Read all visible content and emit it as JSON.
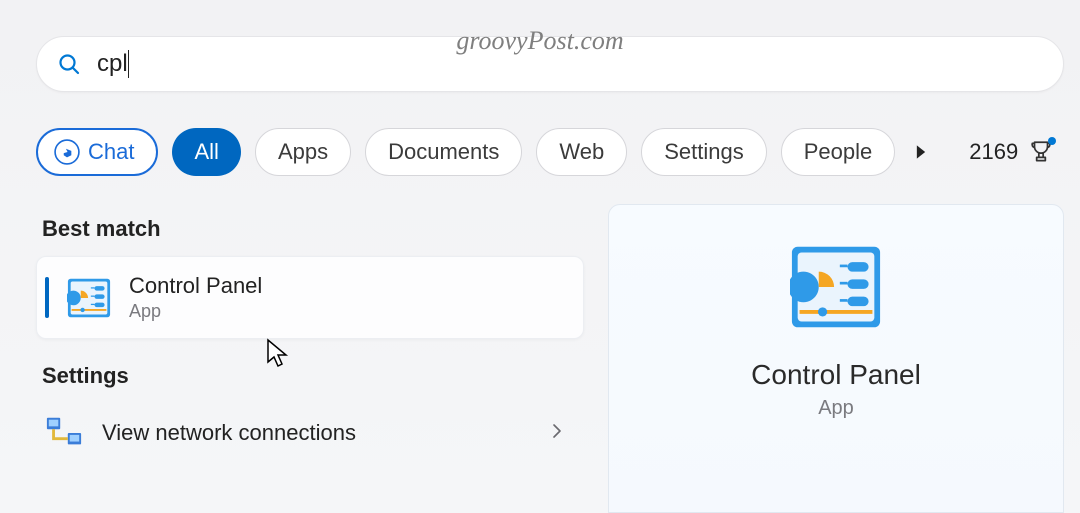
{
  "watermark": "groovyPost.com",
  "search": {
    "value": "cpl"
  },
  "filters": {
    "chat": "Chat",
    "all": "All",
    "items": [
      "Apps",
      "Documents",
      "Web",
      "Settings",
      "People"
    ]
  },
  "points": {
    "value": "2169"
  },
  "sections": {
    "best_match": "Best match",
    "settings": "Settings"
  },
  "best_result": {
    "title": "Control Panel",
    "subtitle": "App"
  },
  "settings_results": [
    {
      "label": "View network connections"
    }
  ],
  "preview": {
    "title": "Control Panel",
    "subtitle": "App"
  }
}
